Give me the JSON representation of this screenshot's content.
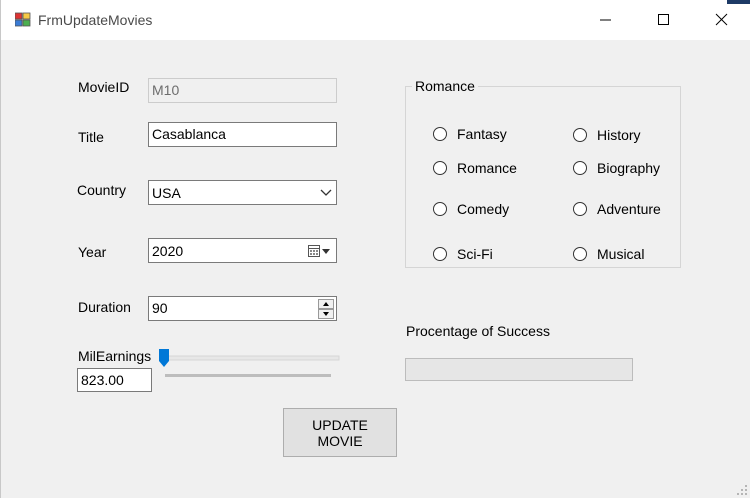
{
  "window": {
    "title": "FrmUpdateMovies"
  },
  "form": {
    "movie_id": {
      "label": "MovieID",
      "value": "M10"
    },
    "title": {
      "label": "Title",
      "value": "Casablanca"
    },
    "country": {
      "label": "Country",
      "value": "USA"
    },
    "year": {
      "label": "Year",
      "value": "2020"
    },
    "duration": {
      "label": "Duration",
      "value": "90"
    },
    "mil_earnings": {
      "label": "MilEarnings",
      "value": "823.00",
      "trackbar_position": 0.0
    }
  },
  "genre_group": {
    "title": "Romance",
    "options": [
      {
        "label": "Fantasy",
        "checked": false
      },
      {
        "label": "History",
        "checked": false
      },
      {
        "label": "Romance",
        "checked": false
      },
      {
        "label": "Biography",
        "checked": false
      },
      {
        "label": "Comedy",
        "checked": false
      },
      {
        "label": "Adventure",
        "checked": false
      },
      {
        "label": "Sci-Fi",
        "checked": false
      },
      {
        "label": "Musical",
        "checked": false
      }
    ]
  },
  "success": {
    "label": "Procentage of Success",
    "progress": 0
  },
  "update_button": {
    "line1": "UPDATE",
    "line2": "MOVIE"
  },
  "colors": {
    "form_bg": "#f0f0f0",
    "accent": "#0078d7",
    "progress_fill": "#06b025"
  }
}
